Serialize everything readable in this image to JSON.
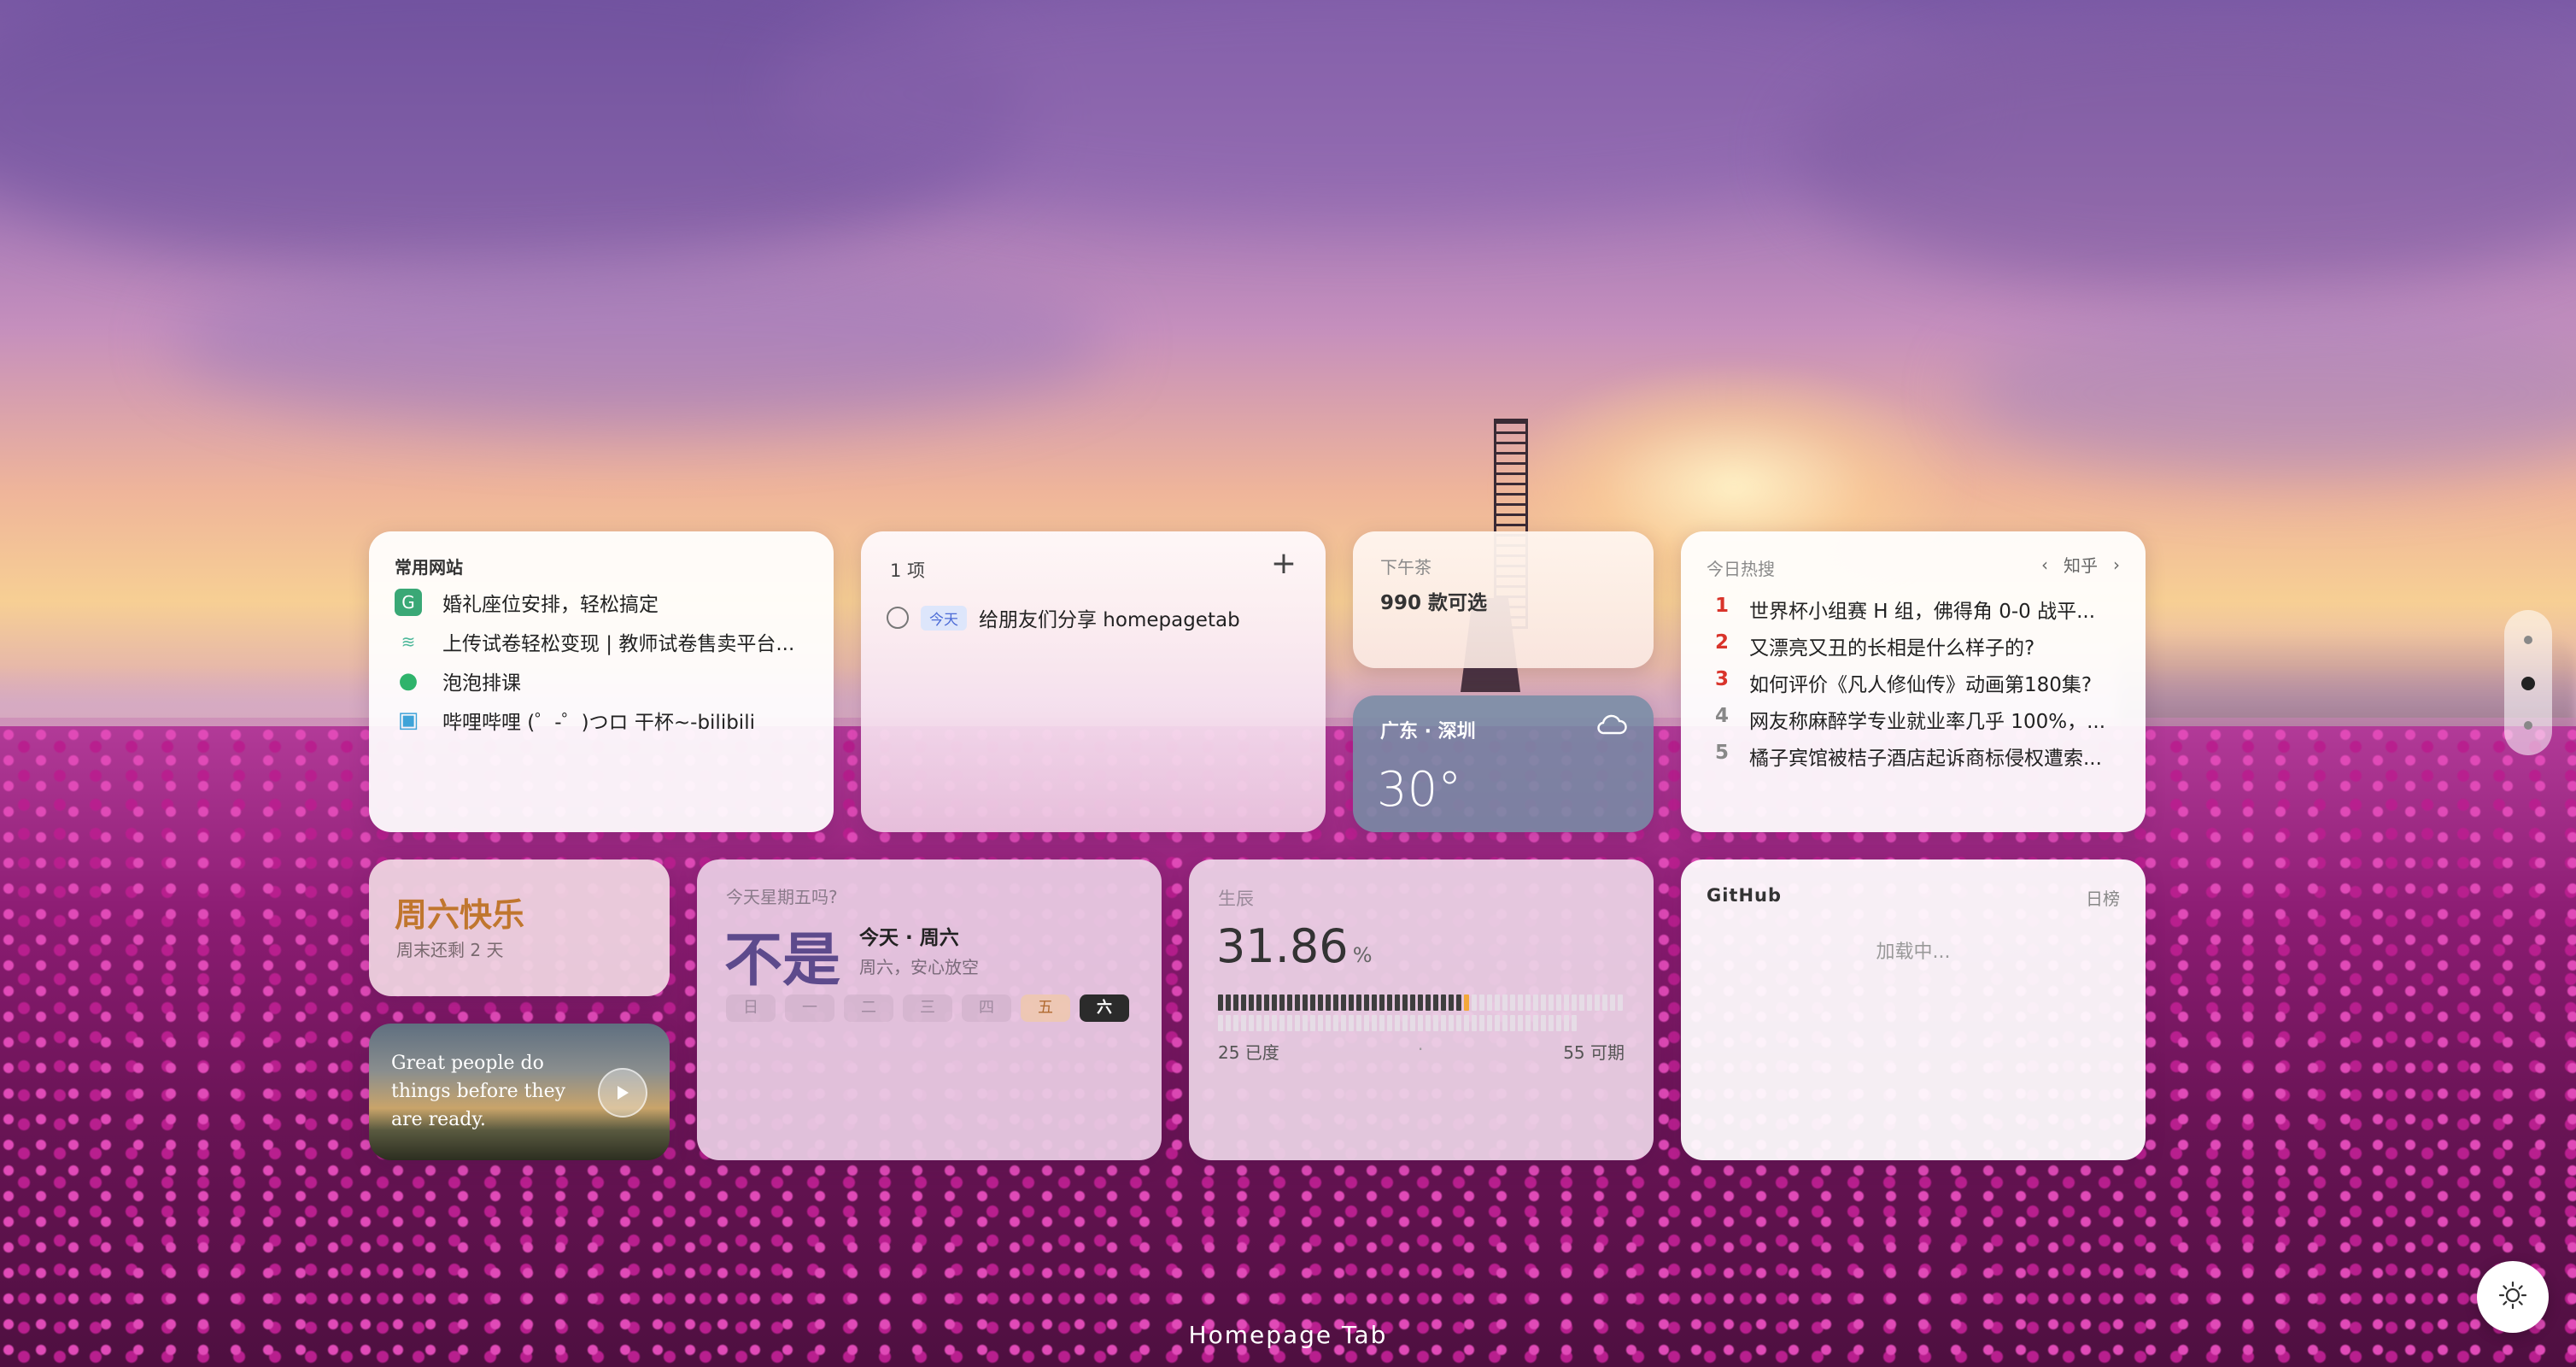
{
  "app": {
    "footer_title": "Homepage Tab"
  },
  "sites": {
    "title": "常用网站",
    "items": [
      {
        "label": "婚礼座位安排，轻松搞定",
        "icon": "g-letter-icon",
        "icon_char": "G",
        "color": "#3aa876"
      },
      {
        "label": "上传试卷轻松变现 | 教师试卷售卖平台...",
        "icon": "layers-icon",
        "icon_char": "≋",
        "color": "#4db89a"
      },
      {
        "label": "泡泡排课",
        "icon": "bubbles-icon",
        "icon_char": "●",
        "color": "#2fb36b"
      },
      {
        "label": "哔哩哔哩 (゜-゜)つロ 干杯~-bilibili",
        "icon": "bilibili-icon",
        "icon_char": "▣",
        "color": "#3fa3d8"
      }
    ]
  },
  "todo": {
    "count_label": "1 项",
    "add_icon": "plus-icon",
    "items": [
      {
        "tag": "今天",
        "text": "给朋友们分享 homepagetab"
      }
    ]
  },
  "tea": {
    "title": "下午茶",
    "value": "990 款可选"
  },
  "weather": {
    "location": "广东 · 深圳",
    "temp": "30°",
    "icon": "cloud-icon"
  },
  "hot": {
    "title": "今日热搜",
    "source": "知乎",
    "items": [
      {
        "rank": "1",
        "text": "世界杯小组赛 H 组，佛得角 0-0 战平...",
        "color": "#d9342b"
      },
      {
        "rank": "2",
        "text": "又漂亮又丑的长相是什么样子的?",
        "color": "#d9342b"
      },
      {
        "rank": "3",
        "text": "如何评价《凡人修仙传》动画第180集?",
        "color": "#d9342b"
      },
      {
        "rank": "4",
        "text": "网友称麻醉学专业就业率几乎 100%，...",
        "color": "#888888"
      },
      {
        "rank": "5",
        "text": "橘子宾馆被桔子酒店起诉商标侵权遭索...",
        "color": "#888888"
      }
    ]
  },
  "weekend": {
    "title": "周六快乐",
    "subtitle": "周末还剩 2 天"
  },
  "quote": {
    "text": "Great people do things before they are ready."
  },
  "friday": {
    "question": "今天星期五吗?",
    "answer": "不是",
    "today": "今天 · 周六",
    "note": "周六，安心放空",
    "days": [
      "日",
      "一",
      "二",
      "三",
      "四",
      "五",
      "六"
    ],
    "friday_index": 5,
    "today_index": 6
  },
  "life": {
    "title": "生辰",
    "value": "31.86",
    "unit": "%",
    "progress": 0.3186,
    "spent": "25 已度",
    "dot": "·",
    "remain": "55 可期"
  },
  "github": {
    "title": "GitHub",
    "range": "日榜",
    "loading": "加载中..."
  },
  "colors": {
    "accent_orange": "#c0762e",
    "friday_purple": "#5d4a8c",
    "today_chip": "#2b2b2b"
  }
}
